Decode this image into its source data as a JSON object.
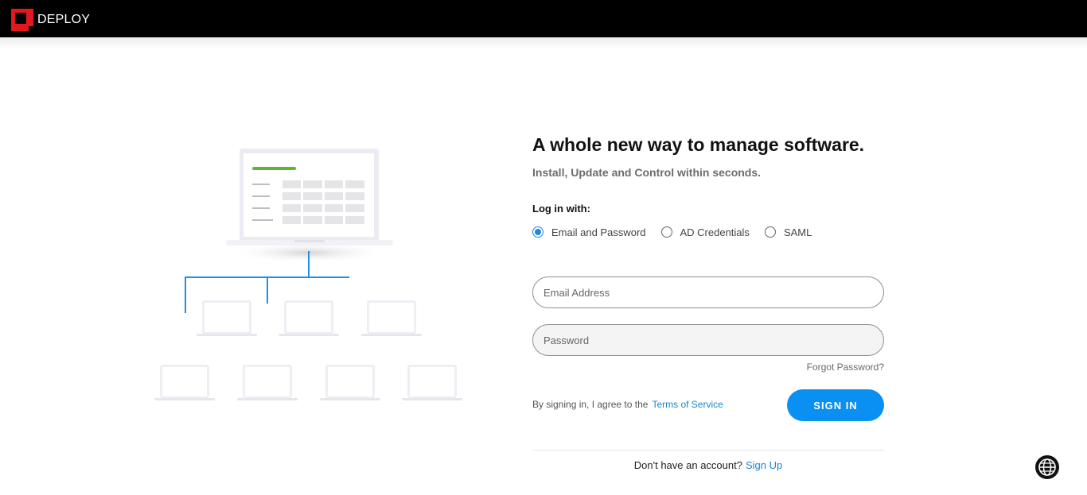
{
  "header": {
    "brand": "DEPLOY",
    "logo_icon": "deploy-logo-icon",
    "background_color": "#000000",
    "logo_color": "#e1191f"
  },
  "hero": {
    "headline": "A whole new way to manage software.",
    "subtitle": "Install, Update and Control within seconds."
  },
  "login": {
    "login_with_label": "Log in with:",
    "methods": [
      {
        "label": "Email and Password",
        "selected": true
      },
      {
        "label": "AD Credentials",
        "selected": false
      },
      {
        "label": "SAML",
        "selected": false
      }
    ],
    "email_placeholder": "Email Address",
    "password_placeholder": "Password",
    "forgot_password": "Forgot Password?",
    "terms_prefix": "By signing in, I agree to the",
    "terms_link": "Terms of Service",
    "sign_in_button": "SIGN IN",
    "no_account_text": "Don't have an account?",
    "sign_up_link": "Sign Up",
    "accent_color": "#0a8ff2"
  },
  "footer": {
    "language_icon": "globe-icon"
  }
}
